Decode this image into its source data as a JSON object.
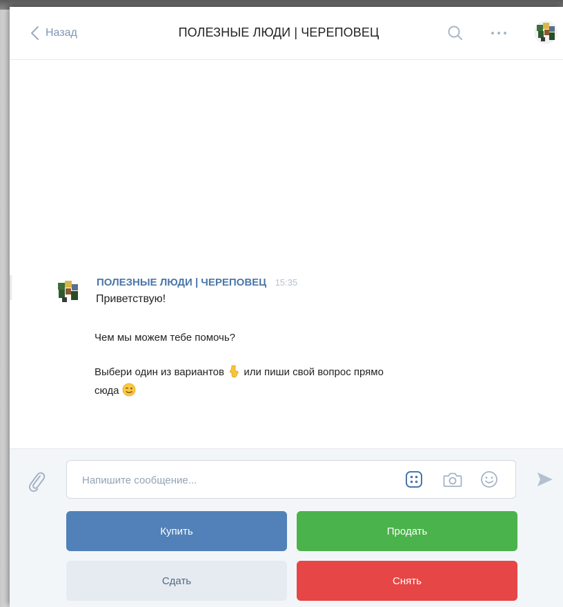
{
  "header": {
    "back_label": "Назад",
    "title": "ПОЛЕЗНЫЕ ЛЮДИ | ЧЕРЕПОВЕЦ",
    "icons": [
      "chevron-left-icon",
      "search-icon",
      "more-icon",
      "community-avatar"
    ]
  },
  "message": {
    "author": "ПОЛЕЗНЫЕ ЛЮДИ | ЧЕРЕПОВЕЦ",
    "time": "15:35",
    "greeting": "Приветствую!",
    "question": "Чем мы можем тебе помочь?",
    "choose_text_before": "Выбери один из вариантов",
    "choose_text_after": "или пиши свой вопрос прямо",
    "here_text": "сюда",
    "emojis": [
      "pointing-down-emoji",
      "winking-face-emoji"
    ]
  },
  "composer": {
    "placeholder": "Напишите сообщение...",
    "value": "",
    "icons": [
      "attach-icon",
      "keyboard-icon",
      "camera-icon",
      "smile-icon",
      "send-icon"
    ]
  },
  "keyboard": {
    "buttons": [
      {
        "label": "Купить",
        "color": "#5181b8"
      },
      {
        "label": "Продать",
        "color": "#4bb34b"
      },
      {
        "label": "Сдать",
        "color": "#e5ebf1"
      },
      {
        "label": "Снять",
        "color": "#e64646"
      }
    ]
  },
  "colors": {
    "accent": "#4a76a8",
    "link": "#7a96b6",
    "timestamp": "#b7c0cc"
  }
}
